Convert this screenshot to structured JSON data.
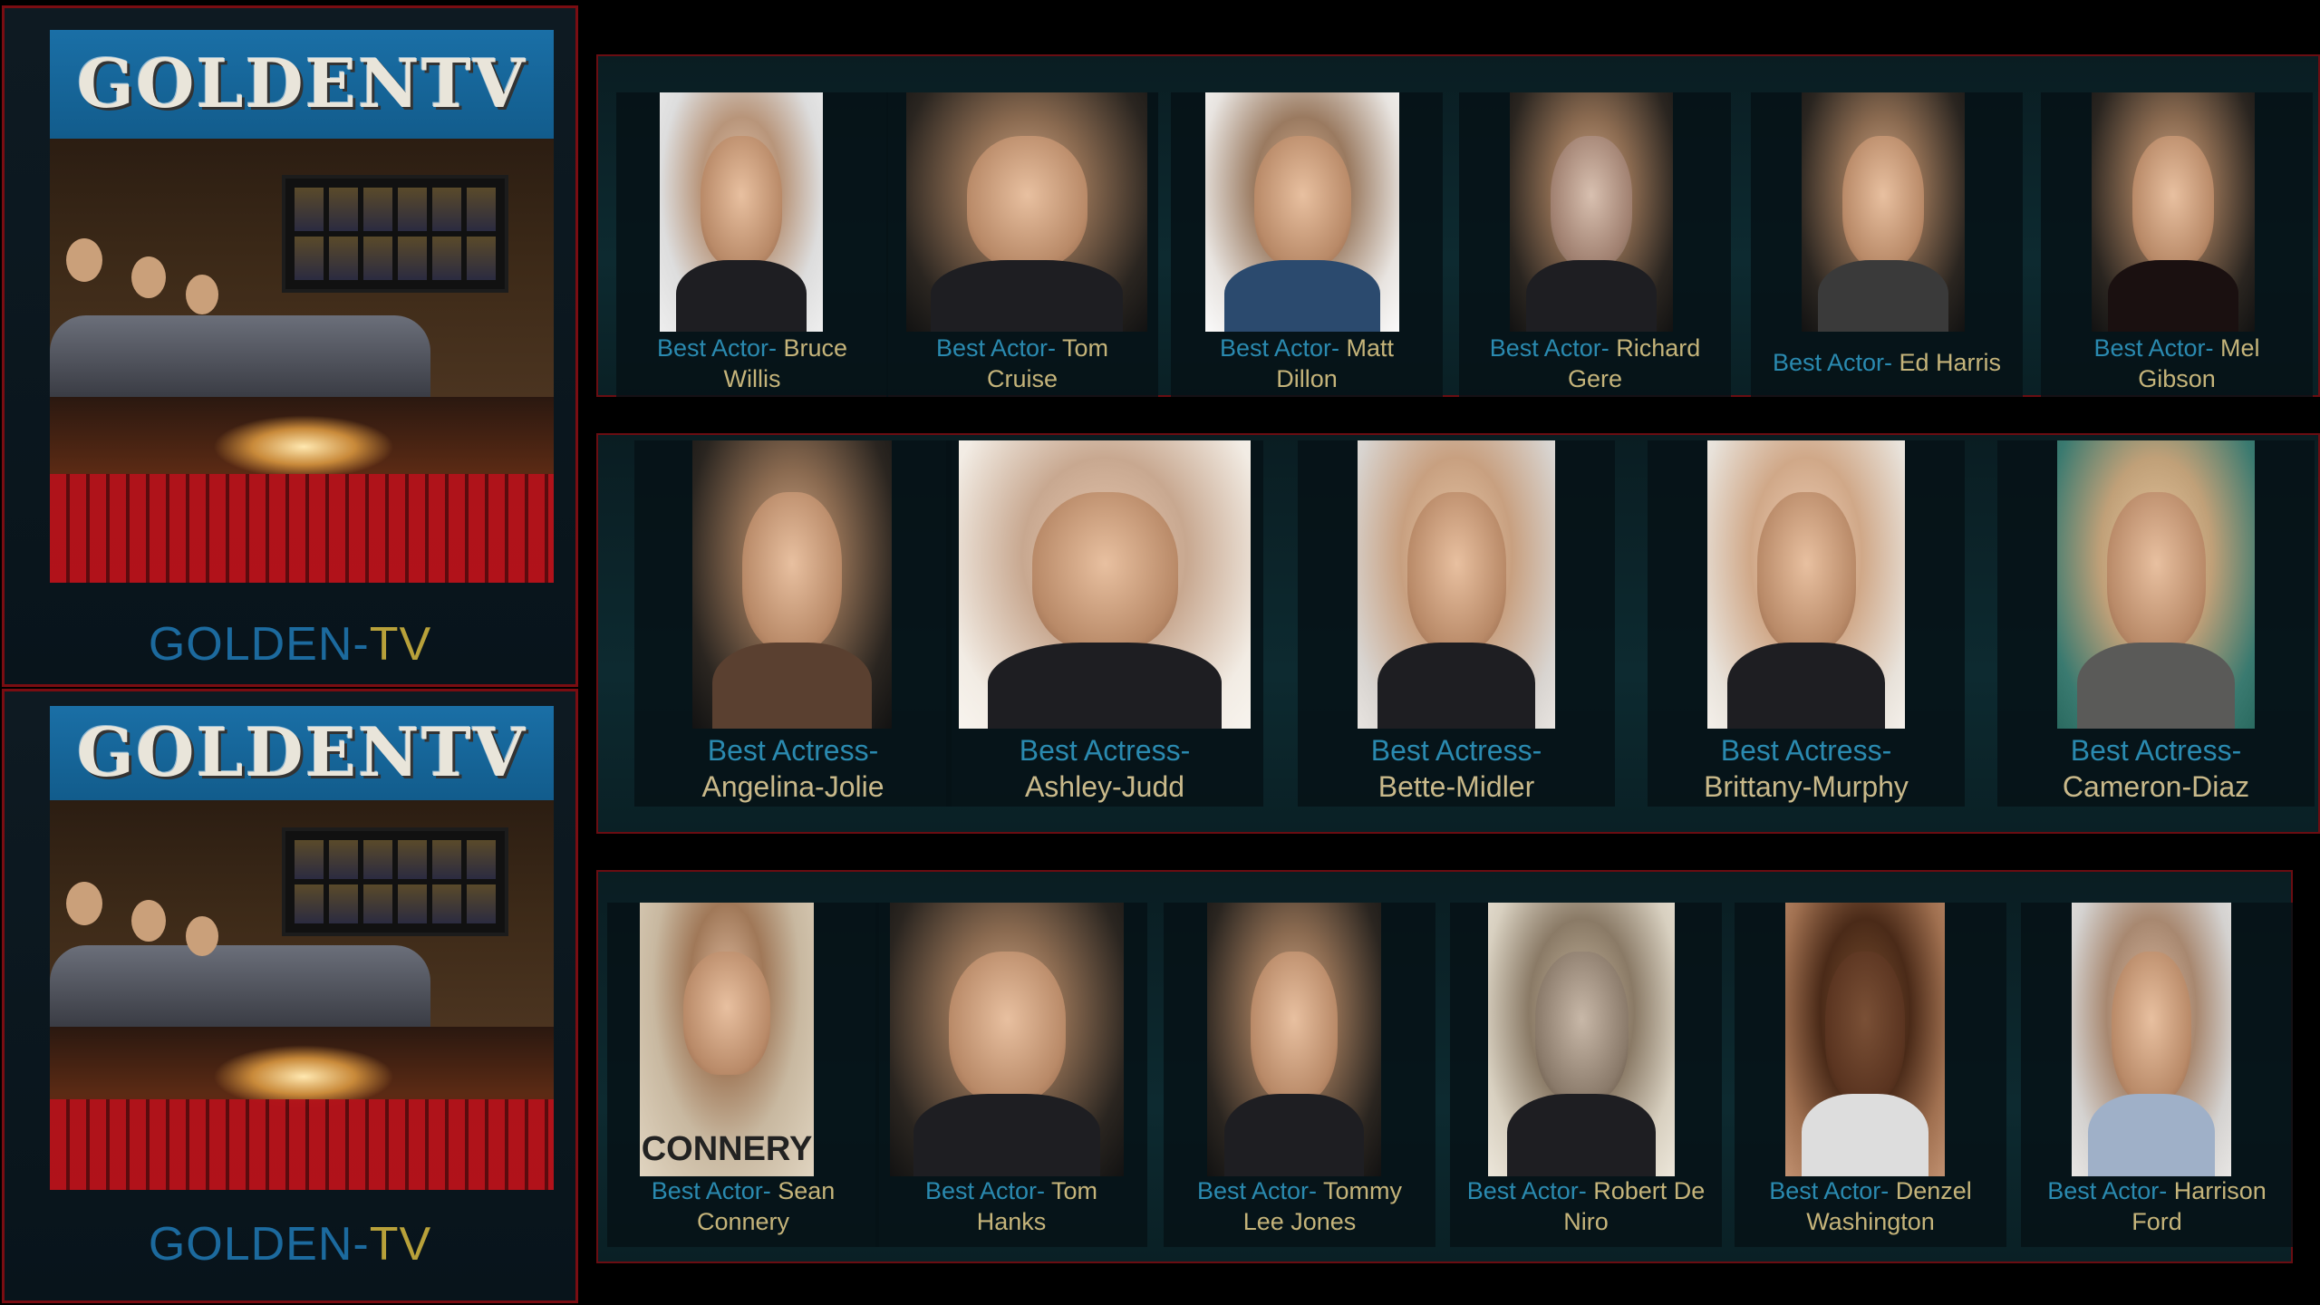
{
  "banners": [
    {
      "logo": "GOLDENTV",
      "caption_part1": "GOLDEN-",
      "caption_part2": "TV"
    },
    {
      "logo": "GOLDENTV",
      "caption_part1": "GOLDEN-",
      "caption_part2": "TV"
    }
  ],
  "rows": [
    {
      "items": [
        {
          "prefix": "Best Actor- ",
          "name": "Bruce",
          "name2": "Willis"
        },
        {
          "prefix": "Best Actor- ",
          "name": "Tom",
          "name2": "Cruise"
        },
        {
          "prefix": "Best Actor- ",
          "name": "Matt",
          "name2": "Dillon"
        },
        {
          "prefix": "Best Actor- ",
          "name": "Richard",
          "name2": "Gere"
        },
        {
          "prefix": "Best Actor- ",
          "name": "Ed Harris",
          "name2": ""
        },
        {
          "prefix": "Best Actor- ",
          "name": "Mel",
          "name2": "Gibson"
        }
      ]
    },
    {
      "items": [
        {
          "prefix": "Best Actress-",
          "name": "Angelina-Jolie"
        },
        {
          "prefix": "Best Actress-",
          "name": "Ashley-Judd"
        },
        {
          "prefix": "Best Actress-",
          "name": "Bette-Midler"
        },
        {
          "prefix": "Best Actress-",
          "name": "Brittany-Murphy"
        },
        {
          "prefix": "Best Actress-",
          "name": "Cameron-Diaz"
        }
      ]
    },
    {
      "items": [
        {
          "prefix": "Best Actor- ",
          "name": "Sean",
          "name2": "Connery",
          "poster_text": "CONNERY"
        },
        {
          "prefix": "Best Actor- ",
          "name": "Tom",
          "name2": "Hanks"
        },
        {
          "prefix": "Best Actor- ",
          "name": "Tommy",
          "name2": "Lee Jones"
        },
        {
          "prefix": "Best Actor- ",
          "name": "Robert De",
          "name2": "Niro"
        },
        {
          "prefix": "Best Actor- ",
          "name": "Denzel",
          "name2": "Washington"
        },
        {
          "prefix": "Best Actor- ",
          "name": "Harrison",
          "name2": "Ford"
        }
      ]
    }
  ]
}
